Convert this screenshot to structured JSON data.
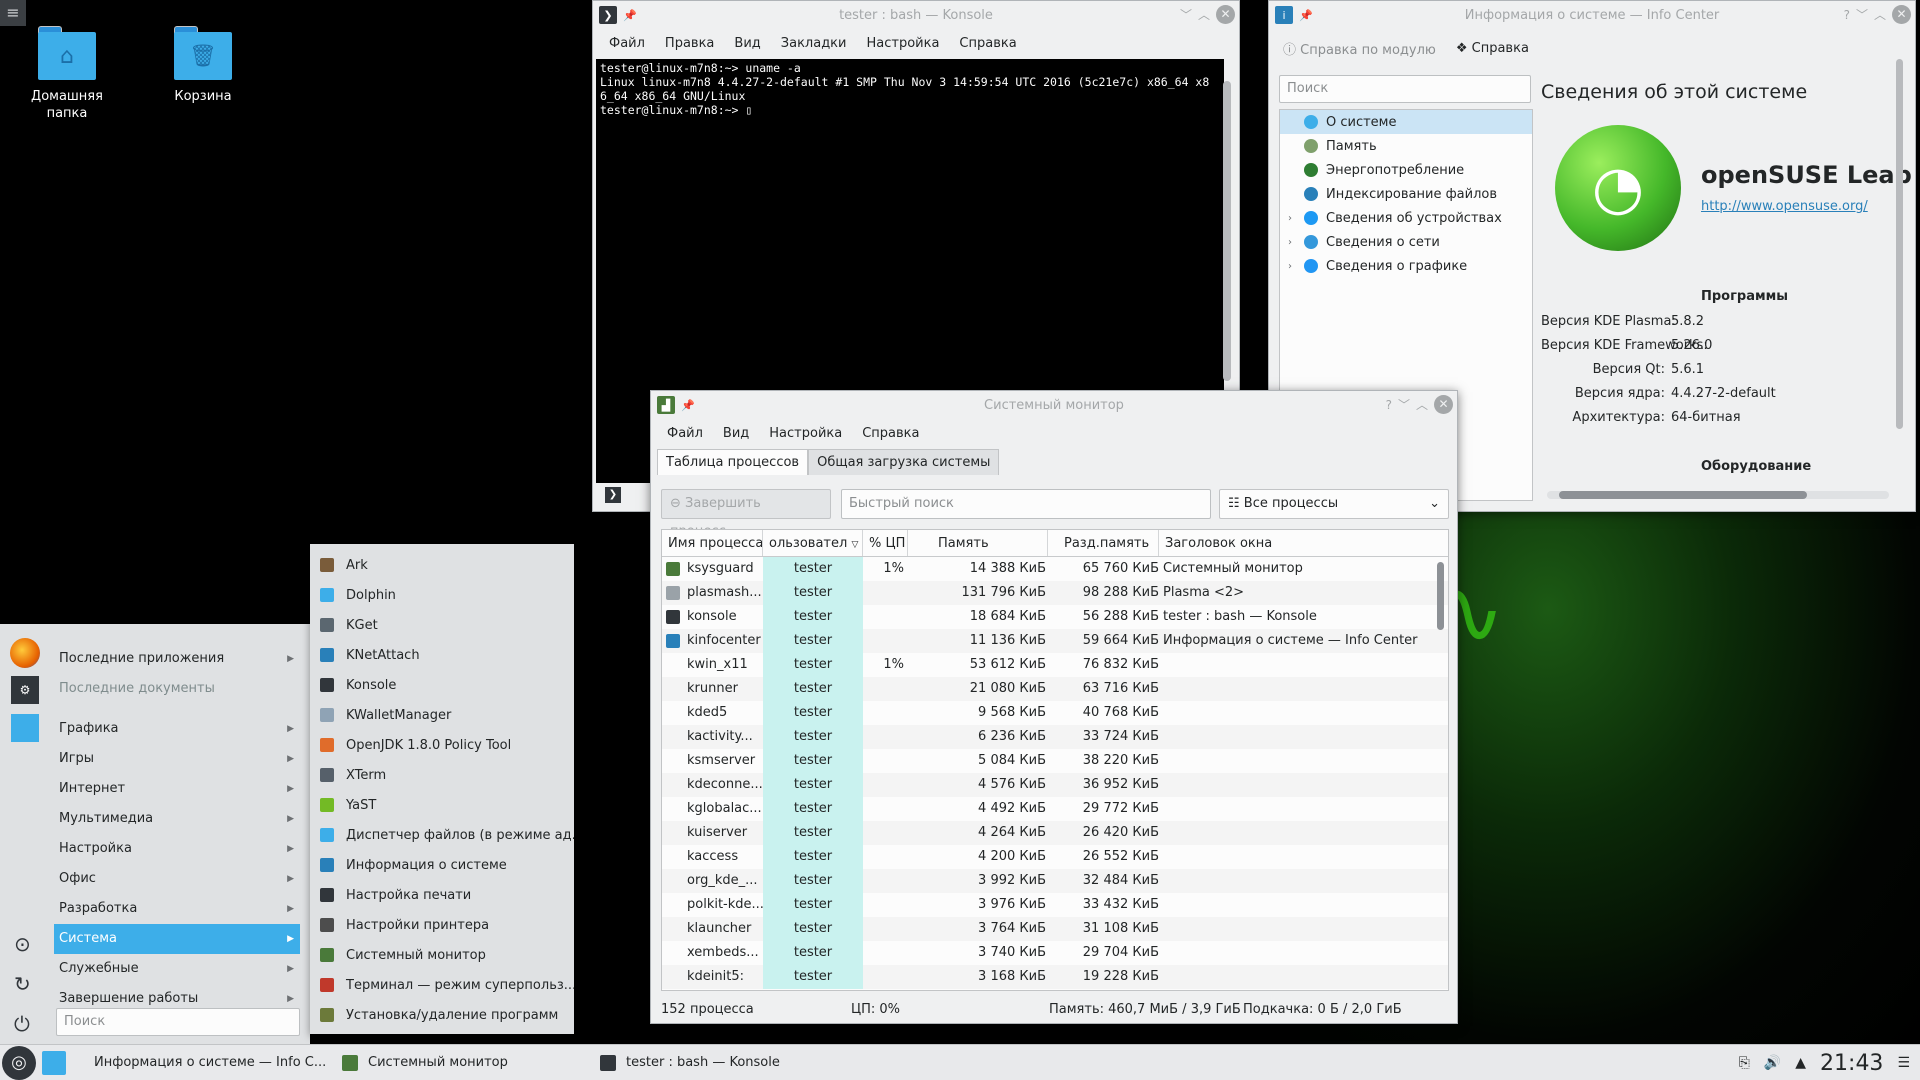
{
  "desktop": {
    "icons": [
      {
        "label": "Домашняя папка",
        "glyph": "⌂"
      },
      {
        "label": "Корзина",
        "glyph": "🗑"
      }
    ]
  },
  "konsole": {
    "title": "tester : bash — Konsole",
    "menu": [
      "Файл",
      "Правка",
      "Вид",
      "Закладки",
      "Настройка",
      "Справка"
    ],
    "lines": [
      "tester@linux-m7n8:~> uname -a",
      "Linux linux-m7n8 4.4.27-2-default #1 SMP Thu Nov 3 14:59:54 UTC 2016 (5c21e7c) x86_64 x8",
      "6_64 x86_64 GNU/Linux",
      "tester@linux-m7n8:~> ▯"
    ]
  },
  "infocenter": {
    "title": "Информация о системе — Info Center",
    "toolbar": {
      "module_help": "Справка по модулю",
      "help": "Справка"
    },
    "search_placeholder": "Поиск",
    "tree": [
      {
        "label": "О системе",
        "selected": true,
        "expandable": false,
        "color": "#3daee9"
      },
      {
        "label": "Память",
        "selected": false,
        "expandable": false,
        "color": "#7fa06c"
      },
      {
        "label": "Энергопотребление",
        "selected": false,
        "expandable": false,
        "color": "#2e7d32"
      },
      {
        "label": "Индексирование файлов",
        "selected": false,
        "expandable": false,
        "color": "#2980b9"
      },
      {
        "label": "Сведения об устройствах",
        "selected": false,
        "expandable": true,
        "color": "#1d99f3"
      },
      {
        "label": "Сведения о сети",
        "selected": false,
        "expandable": true,
        "color": "#3498db"
      },
      {
        "label": "Сведения о графике",
        "selected": false,
        "expandable": true,
        "color": "#2196f3"
      }
    ],
    "heading": "Сведения об этой системе",
    "distro": "openSUSE Leap",
    "url": "http://www.opensuse.org/",
    "software_heading": "Программы",
    "software": [
      {
        "k": "Версия KDE Plasma:",
        "v": "5.8.2"
      },
      {
        "k": "Версия KDE Frameworks:",
        "v": "5.26.0"
      },
      {
        "k": "Версия Qt:",
        "v": "5.6.1"
      },
      {
        "k": "Версия ядра:",
        "v": "4.4.27-2-default"
      },
      {
        "k": "Архитектура:",
        "v": "64-битная"
      }
    ],
    "hardware_heading": "Оборудование"
  },
  "sysmon": {
    "title": "Системный монитор",
    "menu": [
      "Файл",
      "Вид",
      "Настройка",
      "Справка"
    ],
    "tabs": [
      "Таблица процессов",
      "Общая загрузка системы"
    ],
    "kill_button": "Завершить процесс...",
    "quick_search_placeholder": "Быстрый поиск",
    "filter": "Все процессы",
    "columns": [
      "Имя процесса",
      "ользовател",
      "% ЦП",
      "Память",
      "Разд.память",
      "Заголовок окна"
    ],
    "rows": [
      {
        "name": "ksysguard",
        "user": "tester",
        "cpu": "1%",
        "mem": "14 388 КиБ",
        "shared": "65 760 КиБ",
        "title": "Системный монитор",
        "icon": "#4a7a3a"
      },
      {
        "name": "plasmash...",
        "user": "tester",
        "cpu": "",
        "mem": "131 796 КиБ",
        "shared": "98 288 КиБ",
        "title": "Plasma <2>",
        "icon": "#9aa2a8"
      },
      {
        "name": "konsole",
        "user": "tester",
        "cpu": "",
        "mem": "18 684 КиБ",
        "shared": "56 288 КиБ",
        "title": "tester : bash — Konsole",
        "icon": "#31363b"
      },
      {
        "name": "kinfocenter",
        "user": "tester",
        "cpu": "",
        "mem": "11 136 КиБ",
        "shared": "59 664 КиБ",
        "title": "Информация о системе — Info Center",
        "icon": "#2980b9"
      },
      {
        "name": "kwin_x11",
        "user": "tester",
        "cpu": "1%",
        "mem": "53 612 КиБ",
        "shared": "76 832 КиБ",
        "title": "",
        "icon": ""
      },
      {
        "name": "krunner",
        "user": "tester",
        "cpu": "",
        "mem": "21 080 КиБ",
        "shared": "63 716 КиБ",
        "title": "",
        "icon": ""
      },
      {
        "name": "kded5",
        "user": "tester",
        "cpu": "",
        "mem": "9 568 КиБ",
        "shared": "40 768 КиБ",
        "title": "",
        "icon": ""
      },
      {
        "name": "kactivity...",
        "user": "tester",
        "cpu": "",
        "mem": "6 236 КиБ",
        "shared": "33 724 КиБ",
        "title": "",
        "icon": ""
      },
      {
        "name": "ksmserver",
        "user": "tester",
        "cpu": "",
        "mem": "5 084 КиБ",
        "shared": "38 220 КиБ",
        "title": "",
        "icon": ""
      },
      {
        "name": "kdeconne...",
        "user": "tester",
        "cpu": "",
        "mem": "4 576 КиБ",
        "shared": "36 952 КиБ",
        "title": "",
        "icon": ""
      },
      {
        "name": "kglobalac...",
        "user": "tester",
        "cpu": "",
        "mem": "4 492 КиБ",
        "shared": "29 772 КиБ",
        "title": "",
        "icon": ""
      },
      {
        "name": "kuiserver",
        "user": "tester",
        "cpu": "",
        "mem": "4 264 КиБ",
        "shared": "26 420 КиБ",
        "title": "",
        "icon": ""
      },
      {
        "name": "kaccess",
        "user": "tester",
        "cpu": "",
        "mem": "4 200 КиБ",
        "shared": "26 552 КиБ",
        "title": "",
        "icon": ""
      },
      {
        "name": "org_kde_...",
        "user": "tester",
        "cpu": "",
        "mem": "3 992 КиБ",
        "shared": "32 484 КиБ",
        "title": "",
        "icon": ""
      },
      {
        "name": "polkit-kde...",
        "user": "tester",
        "cpu": "",
        "mem": "3 976 КиБ",
        "shared": "33 432 КиБ",
        "title": "",
        "icon": ""
      },
      {
        "name": "klauncher",
        "user": "tester",
        "cpu": "",
        "mem": "3 764 КиБ",
        "shared": "31 108 КиБ",
        "title": "",
        "icon": ""
      },
      {
        "name": "xembeds...",
        "user": "tester",
        "cpu": "",
        "mem": "3 740 КиБ",
        "shared": "29 704 КиБ",
        "title": "",
        "icon": ""
      },
      {
        "name": "kdeinit5:",
        "user": "tester",
        "cpu": "",
        "mem": "3 168 КиБ",
        "shared": "19 228 КиБ",
        "title": "",
        "icon": ""
      }
    ],
    "status": {
      "processes": "152 процесса",
      "cpu": "ЦП: 0%",
      "memory": "Память: 460,7 МиБ / 3,9 ГиБ",
      "swap": "Подкачка: 0 Б / 2,0 ГиБ"
    }
  },
  "launcher": {
    "categories": [
      {
        "label": "Последние приложения",
        "muted": false,
        "selected": false,
        "arrow": true
      },
      {
        "label": "Последние документы",
        "muted": true,
        "selected": false,
        "arrow": false
      },
      {
        "label": "Графика",
        "muted": false,
        "selected": false,
        "arrow": true
      },
      {
        "label": "Игры",
        "muted": false,
        "selected": false,
        "arrow": true
      },
      {
        "label": "Интернет",
        "muted": false,
        "selected": false,
        "arrow": true
      },
      {
        "label": "Мультимедиа",
        "muted": false,
        "selected": false,
        "arrow": true
      },
      {
        "label": "Настройка",
        "muted": false,
        "selected": false,
        "arrow": true
      },
      {
        "label": "Офис",
        "muted": false,
        "selected": false,
        "arrow": true
      },
      {
        "label": "Разработка",
        "muted": false,
        "selected": false,
        "arrow": true
      },
      {
        "label": "Система",
        "muted": false,
        "selected": true,
        "arrow": true
      },
      {
        "label": "Служебные",
        "muted": false,
        "selected": false,
        "arrow": true
      },
      {
        "label": "Завершение работы",
        "muted": false,
        "selected": false,
        "arrow": true
      }
    ],
    "search_placeholder": "Поиск",
    "submenu": [
      {
        "label": "Ark",
        "color": "#7a5c3a"
      },
      {
        "label": "Dolphin",
        "color": "#3daee9"
      },
      {
        "label": "KGet",
        "color": "#5b6770"
      },
      {
        "label": "KNetAttach",
        "color": "#2980b9"
      },
      {
        "label": "Konsole",
        "color": "#31363b"
      },
      {
        "label": "KWalletManager",
        "color": "#8fa3b5"
      },
      {
        "label": "OpenJDK 1.8.0 Policy Tool",
        "color": "#e06c2b"
      },
      {
        "label": "XTerm",
        "color": "#56606a"
      },
      {
        "label": "YaST",
        "color": "#73ba25"
      },
      {
        "label": "Диспетчер файлов (в режиме ад...",
        "color": "#3daee9"
      },
      {
        "label": "Информация о системе",
        "color": "#2980b9"
      },
      {
        "label": "Настройка печати",
        "color": "#31363b"
      },
      {
        "label": "Настройки принтера",
        "color": "#4d4d4d"
      },
      {
        "label": "Системный монитор",
        "color": "#4a7a3a"
      },
      {
        "label": "Терминал — режим суперпольз...",
        "color": "#c0392b"
      },
      {
        "label": "Установка/удаление программ",
        "color": "#6c7a3a"
      }
    ]
  },
  "taskbar": {
    "tasks": [
      {
        "label": "Информация о системе — Info C...",
        "color": "#2980b9"
      },
      {
        "label": "Системный монитор",
        "color": "#4a7a3a"
      },
      {
        "label": "tester : bash — Konsole",
        "color": "#31363b"
      }
    ],
    "clock": "21:43"
  }
}
